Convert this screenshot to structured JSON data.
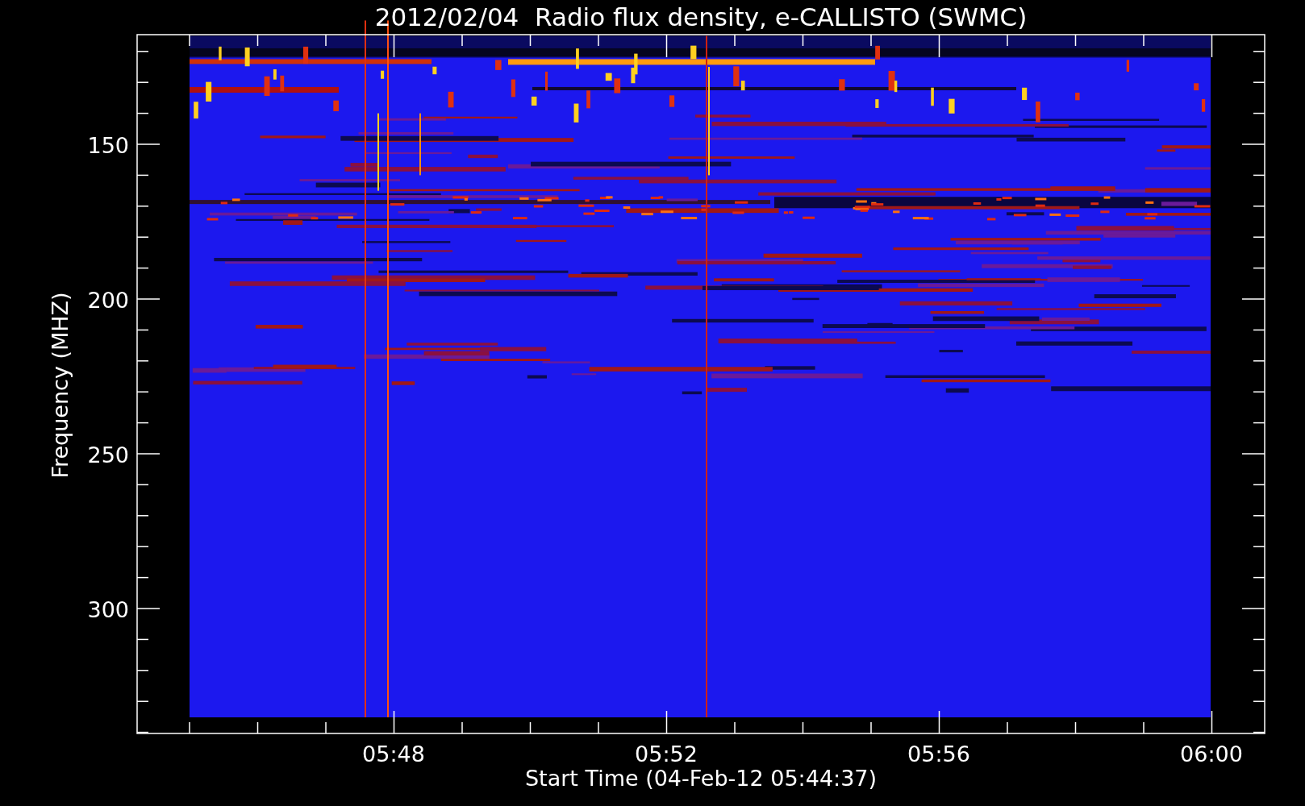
{
  "title": "2012/02/04  Radio flux density, e-CALLISTO (SWMC)",
  "y_axis": {
    "label": "Frequency (MHZ)",
    "ticks": [
      "150",
      "200",
      "250",
      "300"
    ]
  },
  "x_axis": {
    "label": "Start Time (04-Feb-12 05:44:37)",
    "ticks": [
      "05:48",
      "05:52",
      "05:56",
      "06:00"
    ]
  }
}
